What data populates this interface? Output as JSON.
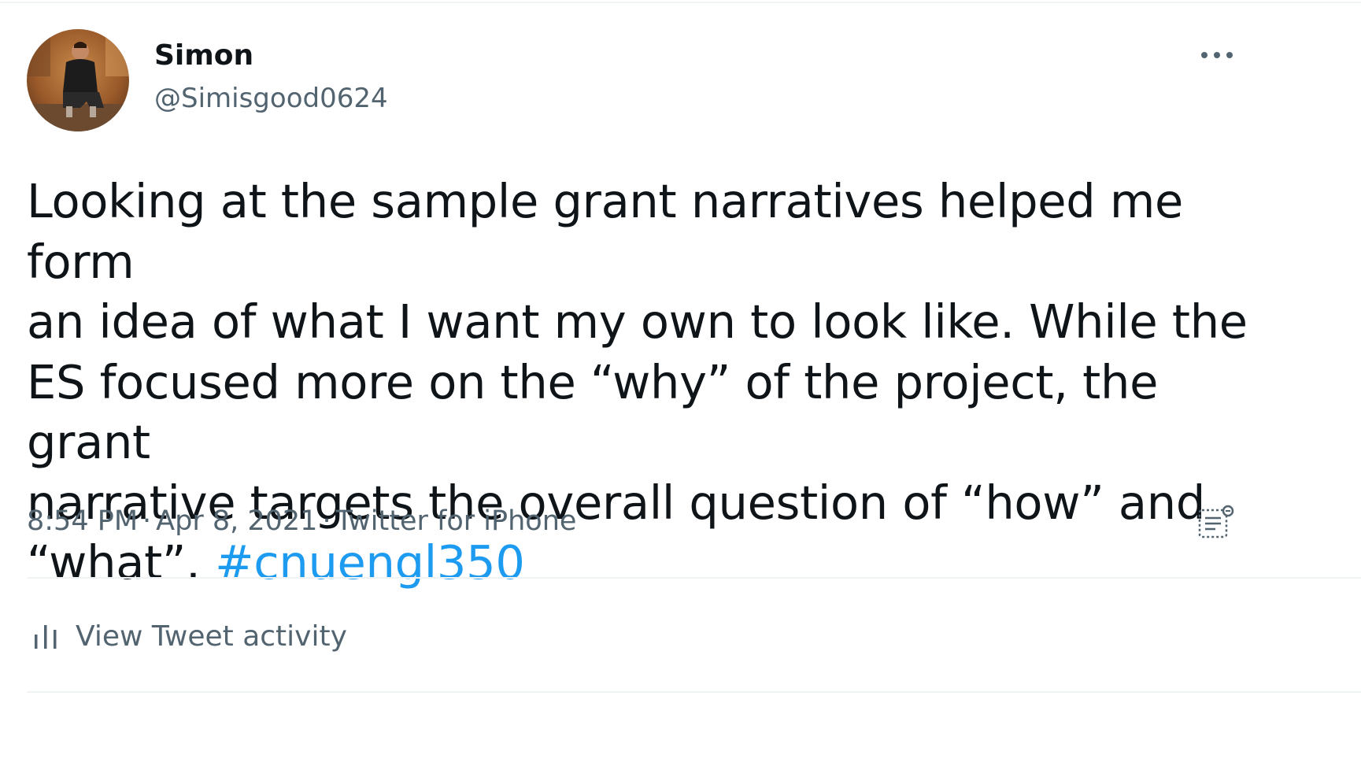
{
  "author": {
    "display_name": "Simon",
    "handle": "@Simisgood0624",
    "avatar_icon": "profile-photo"
  },
  "tweet": {
    "text_lines": [
      "Looking at the sample grant narratives helped me form",
      "an idea of what I want my own to look like. While the",
      "ES focused more on the “why” of the project, the grant",
      "narrative targets the overall question of “how” and",
      "“what”."
    ],
    "hashtag": "#cnuengl350",
    "time": "8:54 PM",
    "date": "Apr 8, 2021",
    "source": "Twitter for iPhone",
    "separator": "·"
  },
  "actions": {
    "more_icon": "more-horizontal-icon",
    "notes_icon": "notes-icon",
    "activity_label": "View Tweet activity",
    "activity_icon": "bar-chart-icon"
  },
  "colors": {
    "text_primary": "#0f1419",
    "text_secondary": "#536471",
    "link": "#1d9bf0",
    "divider": "#eff3f4"
  }
}
